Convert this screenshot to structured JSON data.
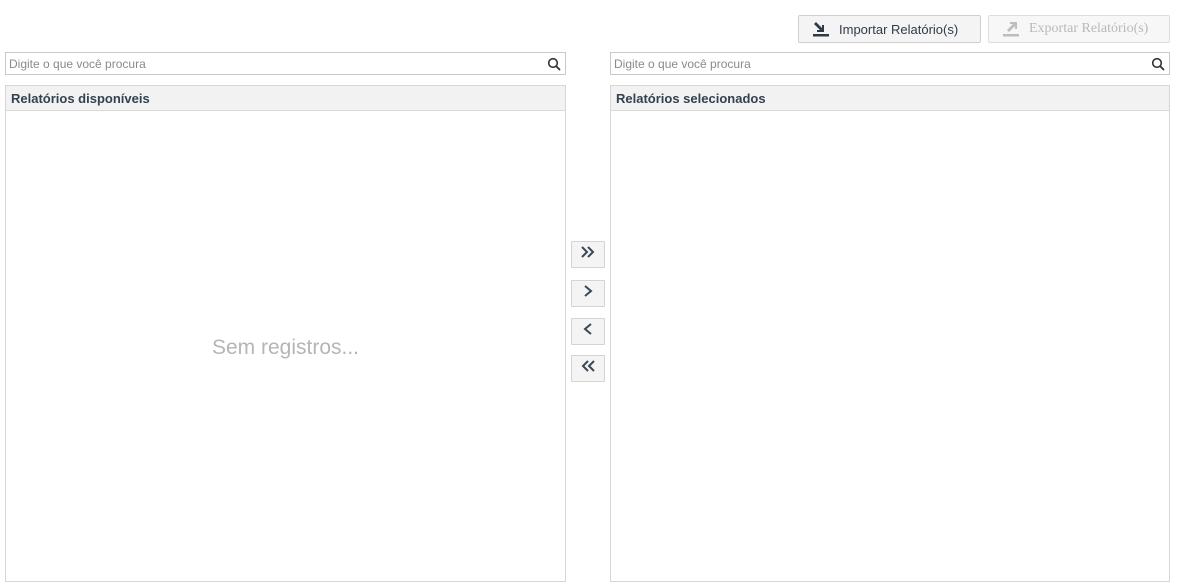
{
  "toolbar": {
    "import_label": "Importar Relatório(s)",
    "export_label": "Exportar Relatório(s)"
  },
  "left": {
    "search_placeholder": "Digite o que você procura",
    "header": "Relatórios disponíveis",
    "empty_text": "Sem registros..."
  },
  "right": {
    "search_placeholder": "Digite o que você procura",
    "header": "Relatórios selecionados"
  },
  "transfer_buttons": {
    "move_all_right": "»",
    "move_right": "›",
    "move_left": "‹",
    "move_all_left": "«"
  },
  "colors": {
    "accent_dark": "#2f3b49",
    "disabled": "#b9b9b9"
  }
}
